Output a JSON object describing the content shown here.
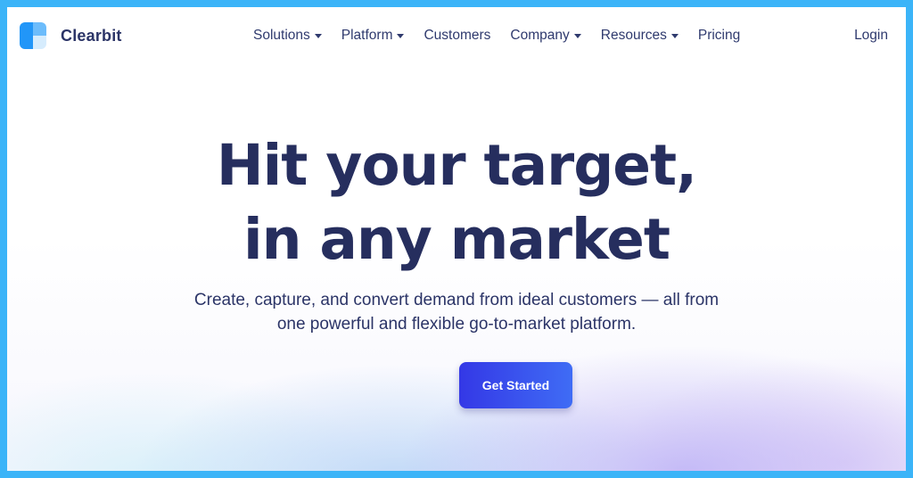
{
  "brand": {
    "name": "Clearbit",
    "logo_icon": "clearbit-logo-icon"
  },
  "nav": {
    "items": [
      {
        "label": "Solutions",
        "has_dropdown": true
      },
      {
        "label": "Platform",
        "has_dropdown": true
      },
      {
        "label": "Customers",
        "has_dropdown": false
      },
      {
        "label": "Company",
        "has_dropdown": true
      },
      {
        "label": "Resources",
        "has_dropdown": true
      },
      {
        "label": "Pricing",
        "has_dropdown": false
      }
    ],
    "login_label": "Login"
  },
  "hero": {
    "headline_line1": "Hit your target,",
    "headline_line2": "in any market",
    "subline_line1": "Create, capture, and convert demand from ideal customers — all from",
    "subline_line2": "one powerful and flexible go-to-market platform.",
    "cta_label": "Get Started"
  },
  "colors": {
    "frame": "#3bb4f8",
    "text": "#262e5e",
    "cta_start": "#3438e6",
    "cta_end": "#3f6cf5"
  }
}
